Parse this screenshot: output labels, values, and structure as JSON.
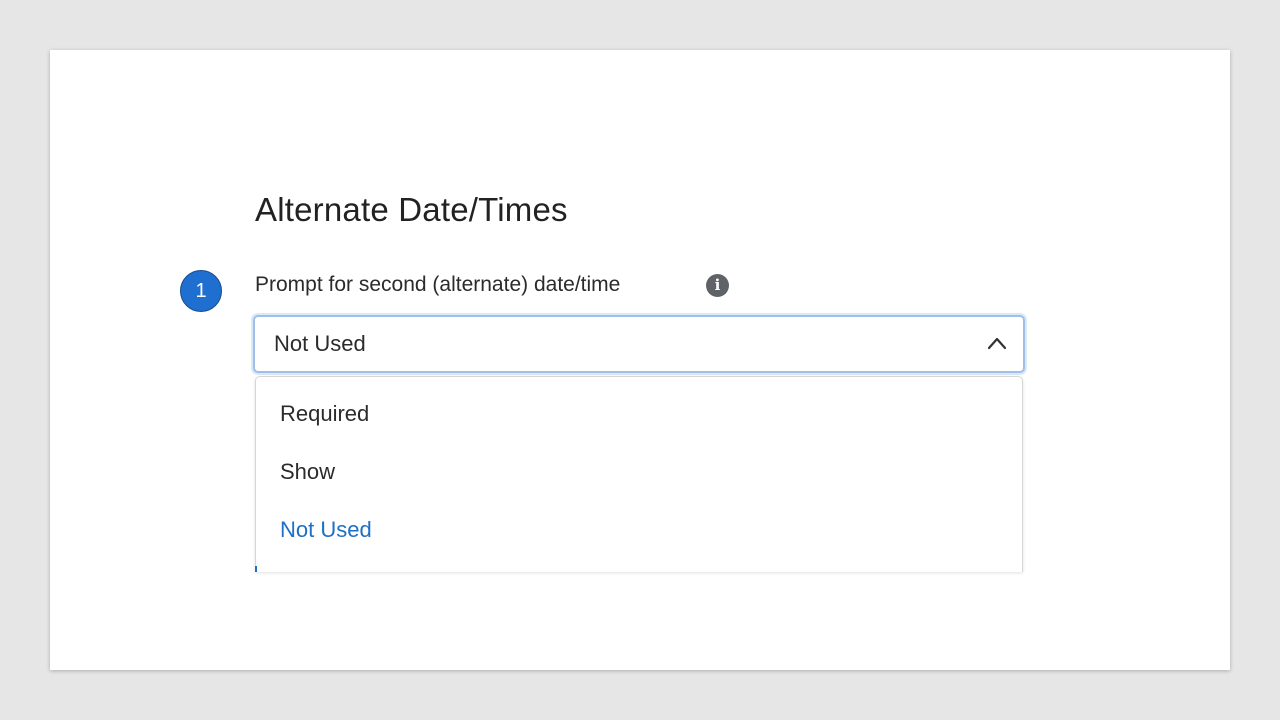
{
  "step_badge": "1",
  "section": {
    "heading": "Alternate Date/Times"
  },
  "field": {
    "label": "Prompt for second (alternate) date/time",
    "info_icon": "i",
    "selected_value": "Not Used",
    "dropdown_state": "open",
    "options": [
      {
        "label": "Required",
        "selected": false
      },
      {
        "label": "Show",
        "selected": false
      },
      {
        "label": "Not Used",
        "selected": true
      }
    ]
  },
  "colors": {
    "accent": "#1f6fc5",
    "badge": "#1f6fd1",
    "focus_border": "#9fbfea",
    "text": "#2b2b2b",
    "background": "#e7e6e6"
  },
  "icons": [
    "info-icon",
    "chevron-up-icon"
  ]
}
